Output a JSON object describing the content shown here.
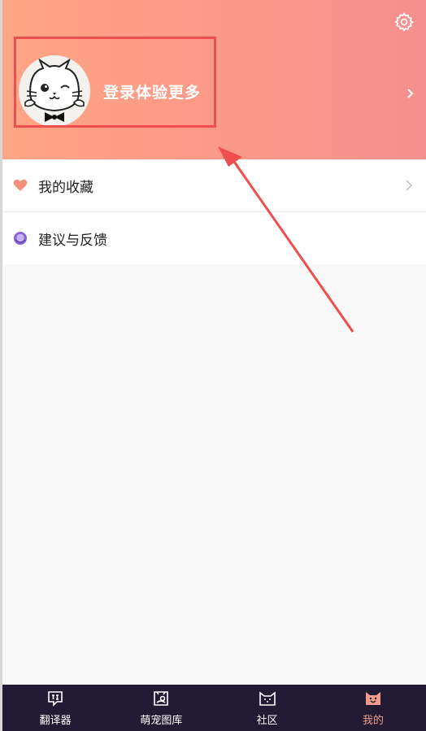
{
  "header": {
    "login_text": "登录体验更多",
    "colors": {
      "gradient_start": "#ffa585",
      "gradient_end": "#f58f8f"
    }
  },
  "icons": {
    "settings": "gear-icon",
    "avatar": "cat-bowtie-avatar",
    "chevron": "chevron-right-icon"
  },
  "menu": {
    "items": [
      {
        "label": "我的收藏",
        "icon": "heart-icon",
        "icon_color": "#f7907a",
        "has_chevron": true
      },
      {
        "label": "建议与反馈",
        "icon": "feedback-icon",
        "icon_color": "#8b63d8",
        "has_chevron": false
      }
    ]
  },
  "tabbar": {
    "items": [
      {
        "label": "翻译器",
        "icon": "translate-icon",
        "active": false
      },
      {
        "label": "萌宠图库",
        "icon": "pet-gallery-icon",
        "active": false
      },
      {
        "label": "社区",
        "icon": "cat-face-icon",
        "active": false
      },
      {
        "label": "我的",
        "icon": "smile-cat-icon",
        "active": true
      }
    ],
    "colors": {
      "background": "#231a33",
      "active": "#f19b8d"
    }
  },
  "annotation": {
    "box_color": "#ee4e4e"
  }
}
